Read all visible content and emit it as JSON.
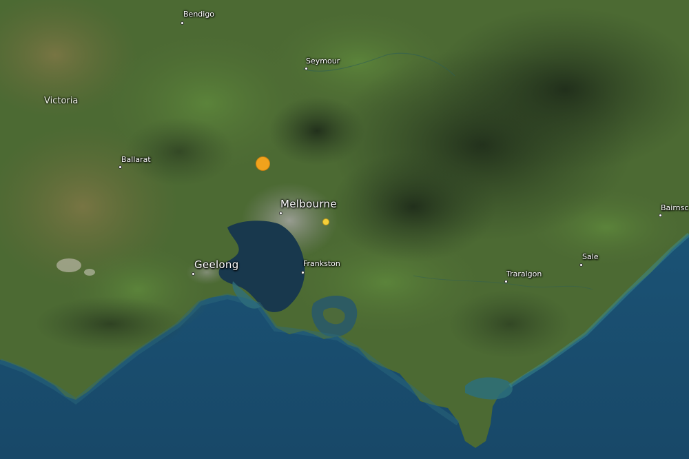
{
  "map": {
    "region_label": "Victoria",
    "places": [
      {
        "id": "bendigo",
        "name": "Bendigo",
        "size": "small"
      },
      {
        "id": "seymour",
        "name": "Seymour",
        "size": "small"
      },
      {
        "id": "ballarat",
        "name": "Ballarat",
        "size": "small"
      },
      {
        "id": "melbourne",
        "name": "Melbourne",
        "size": "large"
      },
      {
        "id": "geelong",
        "name": "Geelong",
        "size": "large"
      },
      {
        "id": "frankston",
        "name": "Frankston",
        "size": "small"
      },
      {
        "id": "traralgon",
        "name": "Traralgon",
        "size": "small"
      },
      {
        "id": "sale",
        "name": "Sale",
        "size": "small"
      },
      {
        "id": "bairnsdale",
        "name": "Bairnsc",
        "size": "small"
      }
    ],
    "quake_markers": [
      {
        "id": "quake-large",
        "color": "#f0a21c",
        "magnitude_class": "large"
      },
      {
        "id": "quake-small",
        "color": "#f5cf3a",
        "magnitude_class": "small"
      }
    ],
    "colors": {
      "ocean": "#1f4f72",
      "land": "#4f6b34",
      "urban": "#8a8f86",
      "bay": "#17394f"
    }
  }
}
